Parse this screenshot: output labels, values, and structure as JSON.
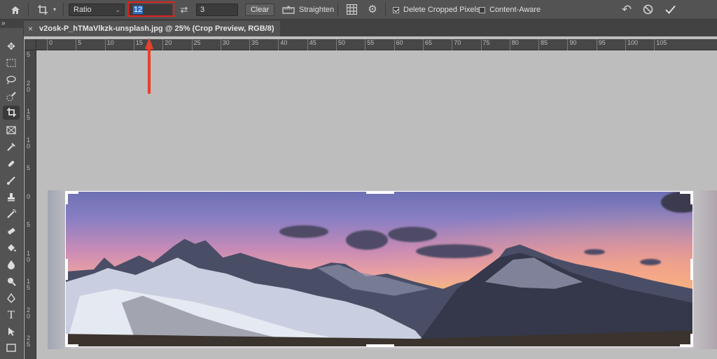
{
  "options_bar": {
    "home_icon": "home-icon",
    "crop_tool_icon": "crop-icon",
    "ratio_select": "Ratio",
    "width_value": "12",
    "swap_icon": "swap-arrows-icon",
    "height_value": "3",
    "clear_label": "Clear",
    "straighten_label": "Straighten",
    "grid_icon": "grid-overlay-icon",
    "settings_icon": "gear-icon",
    "delete_cropped_label": "Delete Cropped Pixels",
    "delete_cropped_checked": true,
    "content_aware_label": "Content-Aware",
    "content_aware_checked": false,
    "reset_icon": "reset-icon",
    "cancel_icon": "cancel-icon",
    "commit_icon": "checkmark-icon"
  },
  "document_tab": {
    "close_label": "×",
    "title": "v2osk-P_hTMaVlkzk-unsplash.jpg @ 25% (Crop Preview, RGB/8)"
  },
  "tabrow_chevron": "»",
  "ruler": {
    "h_ticks": [
      "0",
      "5",
      "10",
      "15",
      "20",
      "25",
      "30",
      "35",
      "40",
      "45",
      "50",
      "55",
      "60",
      "65",
      "70",
      "75",
      "80",
      "85",
      "90",
      "95",
      "100",
      "105"
    ],
    "v_ticks": [
      "5",
      "2 0",
      "1 5",
      "1 0",
      "5",
      "0",
      "5",
      "1 0",
      "1 5",
      "2 0",
      "2 5"
    ]
  },
  "colors": {
    "accent_red": "#e02020",
    "selection_blue": "#2f6fc8"
  }
}
